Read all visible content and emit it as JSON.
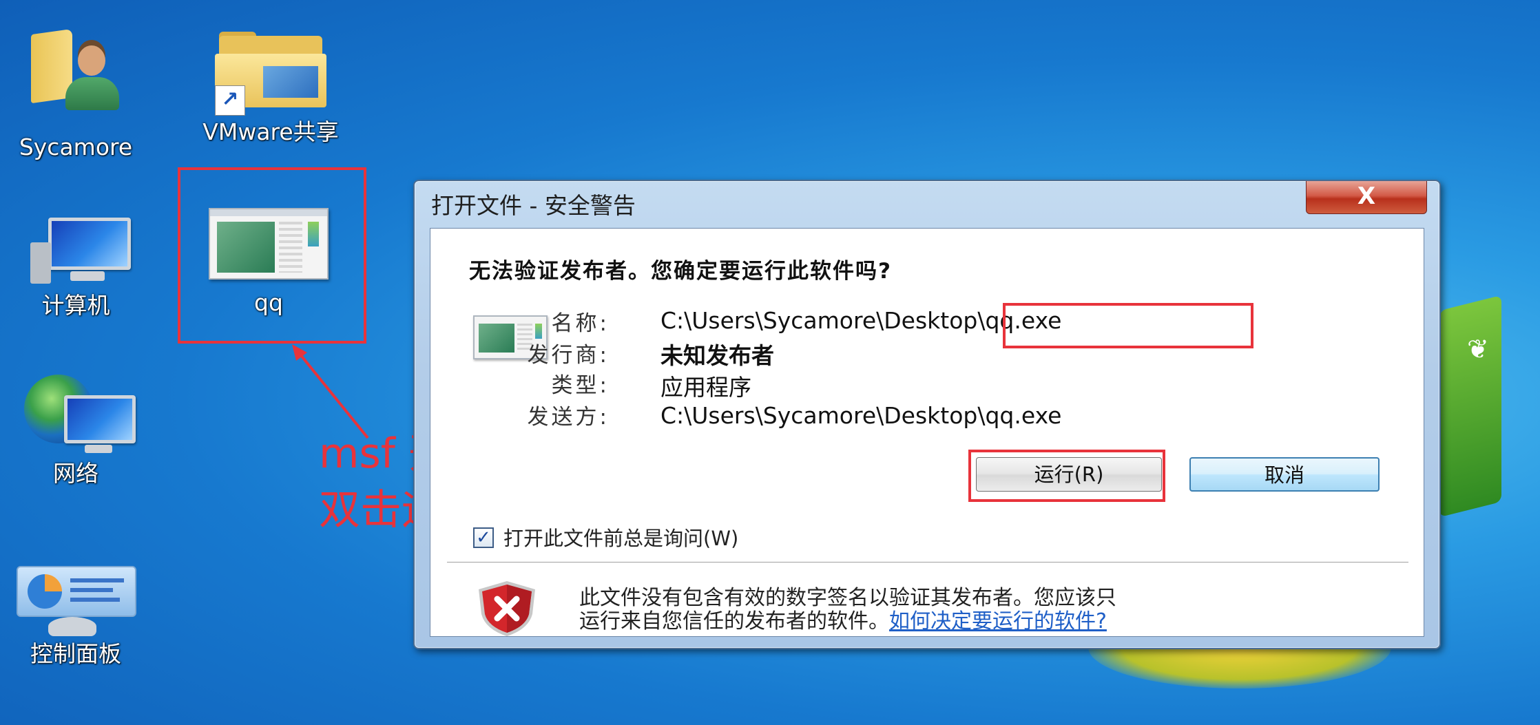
{
  "desktop": {
    "icons": [
      {
        "label": "Sycamore"
      },
      {
        "label": "VMware共享"
      },
      {
        "label": "qq"
      },
      {
        "label": "计算机"
      },
      {
        "label": "网络"
      },
      {
        "label": "控制面板"
      }
    ]
  },
  "annotation": {
    "line1": "msf 开始监听后，",
    "line2": "双击运行上传的木马文件",
    "color": "#e8333b"
  },
  "dialog": {
    "title": "打开文件 - 安全警告",
    "close_label": "X",
    "question": "无法验证发布者。您确定要运行此软件吗?",
    "fields": [
      {
        "key": "名称:",
        "value": "C:\\Users\\Sycamore\\Desktop\\qq.exe"
      },
      {
        "key": "发行商:",
        "value": "未知发布者"
      },
      {
        "key": "类型:",
        "value": "应用程序"
      },
      {
        "key": "发送方:",
        "value": "C:\\Users\\Sycamore\\Desktop\\qq.exe"
      }
    ],
    "run_button": "运行(R)",
    "cancel_button": "取消",
    "checkbox": {
      "label": "打开此文件前总是询问(W)",
      "checked": true
    },
    "warning_line1": "此文件没有包含有效的数字签名以验证其发布者。您应该只",
    "warning_line2": "运行来自您信任的发布者的软件。",
    "help_link": "如何决定要运行的软件?"
  }
}
